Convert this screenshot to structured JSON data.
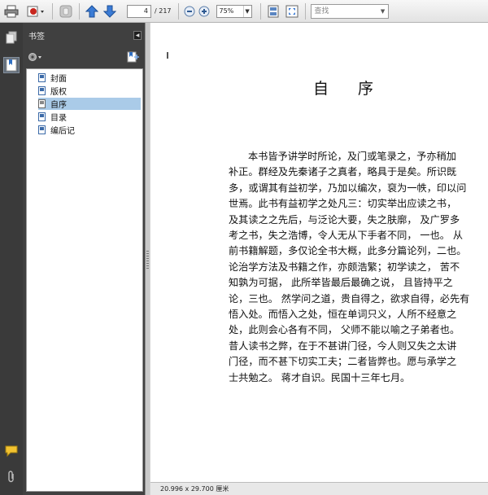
{
  "toolbar": {
    "page_current": "4",
    "page_total": "/ 217",
    "zoom": "75%",
    "search_placeholder": "查找"
  },
  "icons": {
    "print": "print-icon",
    "acrobat": "acrobat-icon",
    "hand": "hand-tool-icon",
    "prev": "arrow-up-icon",
    "next": "arrow-down-icon",
    "zoom_out": "zoom-out-icon",
    "zoom_in": "zoom-in-icon",
    "fit": "fit-page-icon",
    "fullscreen": "fullscreen-icon"
  },
  "bookmarks": {
    "title": "书签",
    "items": [
      {
        "label": "封面",
        "selected": false
      },
      {
        "label": "版权",
        "selected": false
      },
      {
        "label": "自序",
        "selected": true
      },
      {
        "label": "目录",
        "selected": false
      },
      {
        "label": "编后记",
        "selected": false
      }
    ]
  },
  "document": {
    "title": "自序",
    "lines": [
      "本书皆予讲学时所论，及门或笔录之，予亦稍加",
      "补正。群经及先秦诸子之真者，略具于是矣。所识既",
      "多，或谓其有益初学，乃加以编次，裒为一帙，印以问",
      "世焉。此书有益初学之处凡三：切实举出应读之书，",
      "及其读之之先后，与泛论大要，失之肤廓， 及广罗多",
      "考之书，失之浩博，令人无从下手者不同， 一也。 从",
      "前书籍解题，多仅论全书大概，此多分篇论列，二也。",
      "论治学方法及书籍之作，亦颇浩繁；初学读之， 苦不",
      "知孰为可据， 此所举皆最后最确之说， 且皆持平之",
      "论，三也。 然学问之道，贵自得之，欲求自得，必先有",
      "悟入处。而悟入之处，恒在单词只义，人所不经意之",
      "处，此则会心各有不同， 父师不能以喻之子弟者也。",
      "昔人读书之弊，在于不甚讲门径，今人则又失之太讲",
      "门径，而不甚下切实工夫；二者皆弊也。愿与承学之",
      "士共勉之。 蒋才自识。民国十三年七月。"
    ]
  },
  "status": {
    "page_size": "20.996 x 29.700 厘米"
  }
}
